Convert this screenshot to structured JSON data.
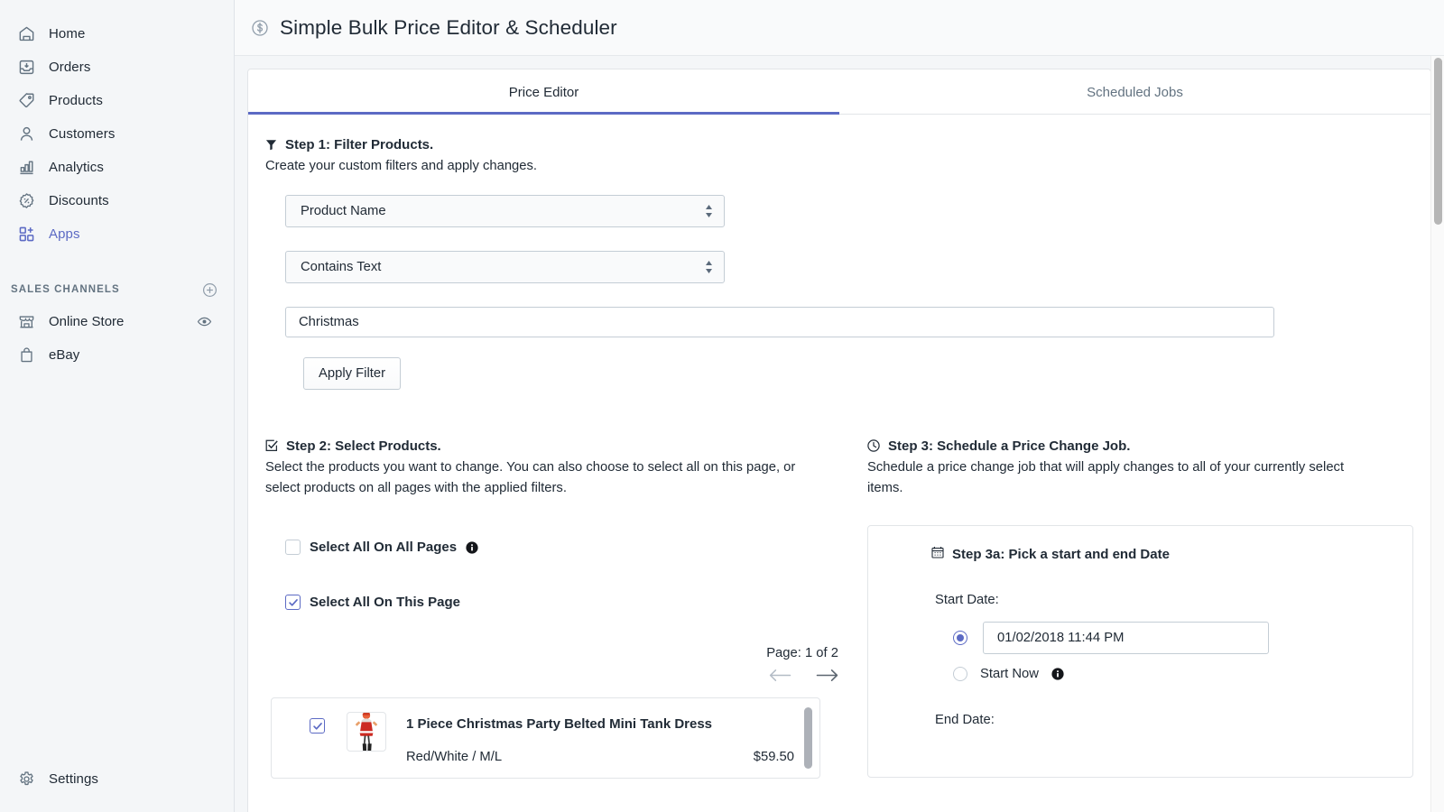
{
  "sidebar": {
    "nav": [
      {
        "label": "Home",
        "icon": "home-icon",
        "active": false
      },
      {
        "label": "Orders",
        "icon": "orders-icon",
        "active": false
      },
      {
        "label": "Products",
        "icon": "products-tag-icon",
        "active": false
      },
      {
        "label": "Customers",
        "icon": "customers-person-icon",
        "active": false
      },
      {
        "label": "Analytics",
        "icon": "analytics-bars-icon",
        "active": false
      },
      {
        "label": "Discounts",
        "icon": "discounts-percent-icon",
        "active": false
      },
      {
        "label": "Apps",
        "icon": "apps-grid-plus-icon",
        "active": true
      }
    ],
    "section_title": "SALES CHANNELS",
    "add_channel_icon": "plus-circle-icon",
    "channels": [
      {
        "label": "Online Store",
        "icon": "storefront-icon",
        "trailing_icon": "eye-icon"
      },
      {
        "label": "eBay",
        "icon": "bag-icon",
        "trailing_icon": ""
      }
    ],
    "settings": {
      "label": "Settings",
      "icon": "gear-icon"
    },
    "accent_color": "#5c6ac4"
  },
  "header": {
    "app_icon": "dollar-circle-icon",
    "title": "Simple Bulk Price Editor & Scheduler"
  },
  "tabs": [
    {
      "label": "Price Editor",
      "active": true
    },
    {
      "label": "Scheduled Jobs",
      "active": false
    }
  ],
  "step1": {
    "icon": "filter-funnel-icon",
    "title": "Step 1: Filter Products.",
    "description": "Create your custom filters and apply changes.",
    "field_select": {
      "value": "Product Name",
      "icon": "updown-caret-icon"
    },
    "condition_select": {
      "value": "Contains Text",
      "icon": "updown-caret-icon"
    },
    "text_value": "Christmas",
    "apply_button": "Apply Filter"
  },
  "step2": {
    "icon": "checkbox-square-icon",
    "title": "Step 2: Select Products.",
    "description": "Select the products you want to change. You can also choose to select all on this page, or select products on all pages with the applied filters.",
    "select_all_pages": {
      "label": "Select All On All Pages",
      "checked": false,
      "info_icon": "info-circle-icon"
    },
    "select_all_this_page": {
      "label": "Select All On This Page",
      "checked": true
    },
    "pagination": {
      "text": "Page: 1 of 2",
      "prev_icon": "arrow-left-icon",
      "next_icon": "arrow-right-icon"
    },
    "products": [
      {
        "checked": true,
        "thumbnail": "christmas-dress-thumbnail",
        "title": "1 Piece Christmas Party Belted Mini Tank Dress",
        "variant": "Red/White / M/L",
        "price": "$59.50"
      }
    ]
  },
  "step3": {
    "icon": "clock-icon",
    "title": "Step 3: Schedule a Price Change Job.",
    "description": "Schedule a price change job that will apply changes to all of your currently select items.",
    "step3a": {
      "icon": "calendar-icon",
      "title": "Step 3a: Pick a start and end Date",
      "start_label": "Start Date:",
      "start_date_value": "01/02/2018 11:44 PM",
      "start_date_selected": true,
      "start_now_label": "Start Now",
      "start_now_selected": false,
      "start_now_info_icon": "info-circle-icon",
      "end_label": "End Date:"
    }
  },
  "scrollbar": {
    "name": "page-vertical-scrollbar"
  }
}
